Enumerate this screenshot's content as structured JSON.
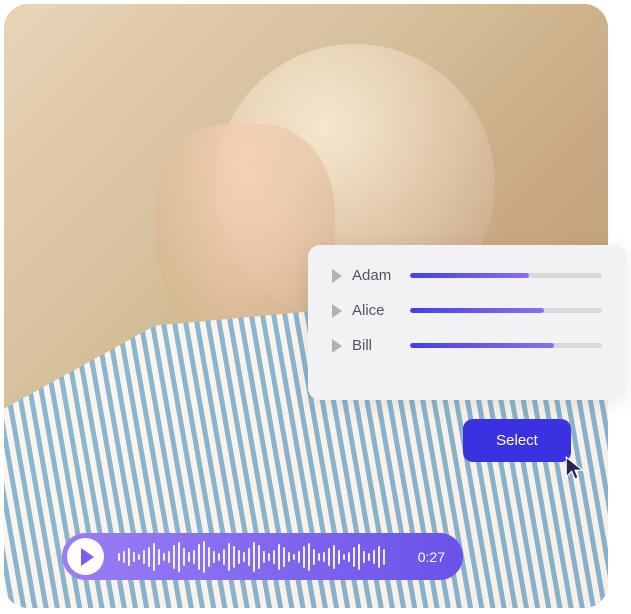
{
  "voices": [
    {
      "name": "Adam",
      "progress": 62
    },
    {
      "name": "Alice",
      "progress": 70
    },
    {
      "name": "Bill",
      "progress": 75
    }
  ],
  "select_button_label": "Select",
  "audio": {
    "timestamp": "0:27",
    "waveform_heights": [
      8,
      12,
      18,
      10,
      6,
      14,
      20,
      28,
      16,
      8,
      12,
      24,
      30,
      18,
      10,
      14,
      26,
      32,
      20,
      12,
      8,
      16,
      28,
      22,
      14,
      10,
      18,
      30,
      24,
      12,
      8,
      14,
      26,
      20,
      10,
      6,
      12,
      22,
      28,
      16,
      8,
      10,
      18,
      24,
      14,
      6,
      10,
      20,
      26,
      12,
      8,
      14,
      22,
      16
    ]
  }
}
